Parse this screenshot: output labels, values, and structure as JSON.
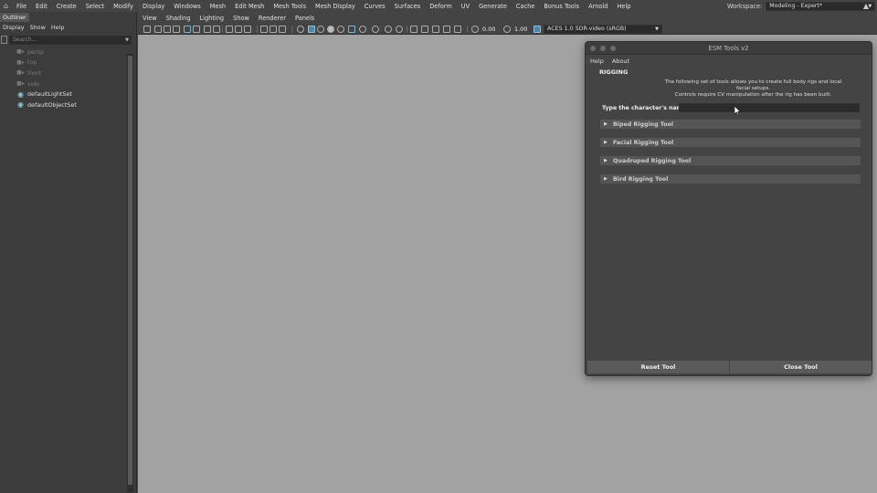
{
  "menubar": {
    "items": [
      "File",
      "Edit",
      "Create",
      "Select",
      "Modify",
      "Display",
      "Windows",
      "Mesh",
      "Edit Mesh",
      "Mesh Tools",
      "Mesh Display",
      "Curves",
      "Surfaces",
      "Deform",
      "UV",
      "Generate",
      "Cache",
      "Bonus Tools",
      "Arnold",
      "Help"
    ],
    "workspace_label": "Workspace:",
    "workspace_value": "Modeling - Expert*"
  },
  "outliner": {
    "tab": "Outliner",
    "menu": [
      "Display",
      "Show",
      "Help"
    ],
    "search_placeholder": "Search...",
    "items": [
      {
        "label": "persp",
        "icon": "camera-icon",
        "dim": true
      },
      {
        "label": "top",
        "icon": "camera-icon",
        "dim": true
      },
      {
        "label": "front",
        "icon": "camera-icon",
        "dim": true
      },
      {
        "label": "side",
        "icon": "camera-icon",
        "dim": true
      },
      {
        "label": "defaultLightSet",
        "icon": "set-icon",
        "dim": false
      },
      {
        "label": "defaultObjectSet",
        "icon": "set-icon",
        "dim": false
      }
    ]
  },
  "viewport": {
    "menu": [
      "View",
      "Shading",
      "Lighting",
      "Show",
      "Renderer",
      "Panels"
    ],
    "exposure": "0.00",
    "gamma": "1.00",
    "color_space": "ACES 1.0 SDR-video (sRGB)"
  },
  "dialog": {
    "title": "ESM Tools v2",
    "menu": [
      "Help",
      "About"
    ],
    "section": "RIGGING",
    "description_line1": "The following set of tools allows you to create full body rigs and local facial setups.",
    "description_line2": "Controls require CV manipulation after the rig has been built.",
    "name_label": "Type the character's name",
    "name_value": "",
    "tools": [
      "Biped Rigging Tool",
      "Facial Rigging Tool",
      "Quadruped Rigging Tool",
      "Bird Rigging Tool"
    ],
    "reset_label": "Reset Tool",
    "close_label": "Close Tool"
  }
}
